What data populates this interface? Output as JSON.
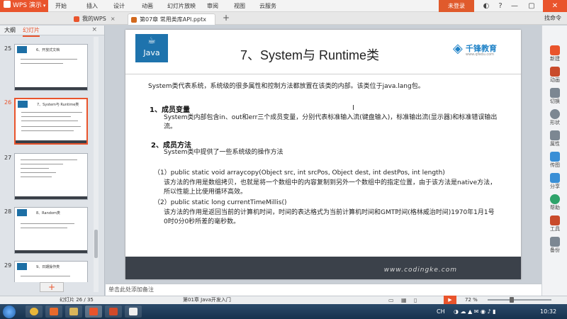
{
  "app": {
    "name": "WPS 演示",
    "menu": [
      "开始",
      "插入",
      "设计",
      "动画",
      "幻灯片放映",
      "审阅",
      "视图",
      "云服务"
    ],
    "active_menu": "开始",
    "login": "未登录"
  },
  "tabs": [
    {
      "label": "我的WPS",
      "active": false
    },
    {
      "label": "第07章 常用类库API.pptx *",
      "active": true
    }
  ],
  "tab_controls": {
    "new_tab": "+",
    "commands": "找命令"
  },
  "left_panel": {
    "tabs": [
      "大纲",
      "幻灯片"
    ],
    "selected_tab": "幻灯片",
    "thumbnails": [
      {
        "num": "25",
        "title": "6、开放式文档"
      },
      {
        "num": "26",
        "title": "7、System与 Runtime类",
        "selected": true
      },
      {
        "num": "27",
        "title": ""
      },
      {
        "num": "28",
        "title": "8、Random类"
      },
      {
        "num": "29",
        "title": "9、日期操作类"
      }
    ],
    "add_slide": "+"
  },
  "slide": {
    "logo_text": "Java",
    "title": "7、System与 Runtime类",
    "brand_name": "千锋教育",
    "brand_sub": "www.qfedu.com",
    "intro": "System类代表系统，系统级的很多属性和控制方法都放置在该类的内部。该类位于java.lang包。",
    "section1_head": "1、成员变量",
    "section1_body": "System类内部包含in、out和err三个成员变量，分别代表标准输入流(键盘输入)，标准输出流(显示器)和标准错误输出流。",
    "section2_head": "2、成员方法",
    "section2_body": "System类中提供了一些系统级的操作方法",
    "method1_sig": "（1）public static void arraycopy(Object src, int srcPos, Object dest, int destPos, int length)",
    "method1_desc": "该方法的作用是数组拷贝，也就是将一个数组中的内容复制到另外一个数组中的指定位置，由于该方法是native方法，所以性能上比使用循环高效。",
    "method2_sig": "（2）public static long currentTimeMillis()",
    "method2_desc": "该方法的作用是返回当前的计算机时间，时间的表达格式为当前计算机时间和GMT时间(格林威治时间)1970年1月1号0时0分0秒所差的毫秒数。",
    "footer_url": "www.codingke.com"
  },
  "right_panel": [
    "新建",
    "动画",
    "切换",
    "形状",
    "属性",
    "传图",
    "分享",
    "帮助",
    "工具",
    "备份"
  ],
  "notes_placeholder": "单击此处添加备注",
  "status": {
    "slide_info": "幻灯片 26 / 35",
    "template": "第01章 Java开发入门",
    "zoom": "72 %"
  },
  "taskbar": {
    "lang": "CH",
    "time": "10:32"
  }
}
